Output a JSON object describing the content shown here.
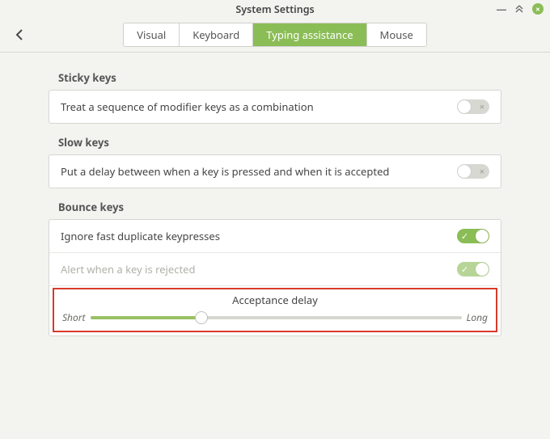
{
  "window": {
    "title": "System Settings"
  },
  "tabs": {
    "visual": "Visual",
    "keyboard": "Keyboard",
    "typing_assistance": "Typing assistance",
    "mouse": "Mouse",
    "active": "typing_assistance"
  },
  "sections": {
    "sticky": {
      "title": "Sticky keys",
      "row1_label": "Treat a sequence of modifier keys as a combination",
      "row1_on": false
    },
    "slow": {
      "title": "Slow keys",
      "row1_label": "Put a delay between when a key is pressed and when it is accepted",
      "row1_on": false
    },
    "bounce": {
      "title": "Bounce keys",
      "row1_label": "Ignore fast duplicate keypresses",
      "row1_on": true,
      "row2_label": "Alert when a key is rejected",
      "row2_on": true,
      "row2_disabled": true,
      "slider": {
        "title": "Acceptance delay",
        "left": "Short",
        "right": "Long",
        "value_percent": 30
      }
    }
  }
}
